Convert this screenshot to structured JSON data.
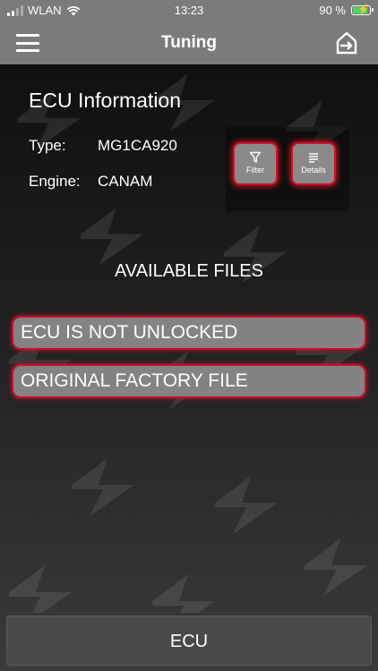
{
  "status_bar": {
    "carrier": "WLAN",
    "time": "13:23",
    "battery_percent": "90 %",
    "battery_level": 0.9,
    "battery_color": "#4cd964"
  },
  "nav": {
    "title": "Tuning",
    "menu_icon": "hamburger-menu-icon",
    "export_icon": "export-icon"
  },
  "ecu_info": {
    "title": "ECU Information",
    "type_label": "Type:",
    "type_value": "MG1CA920",
    "engine_label": "Engine:",
    "engine_value": "CANAM"
  },
  "actions": {
    "filter_label": "Filter",
    "filter_icon": "filter-icon",
    "details_label": "Details",
    "details_icon": "list-icon"
  },
  "files": {
    "heading": "AVAILABLE FILES",
    "items": [
      {
        "label": "ECU IS NOT UNLOCKED"
      },
      {
        "label": "ORIGINAL FACTORY FILE"
      }
    ]
  },
  "bottom": {
    "button_label": "ECU"
  },
  "colors": {
    "accent_red": "#c9102a",
    "bar_gray": "#7b7b7b"
  }
}
